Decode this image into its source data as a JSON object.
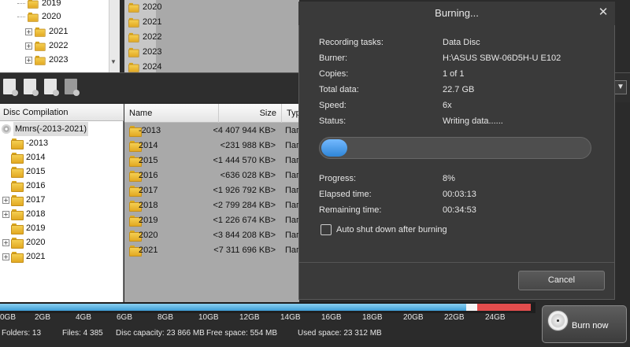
{
  "top_tree": {
    "years": [
      "2019",
      "2020",
      "2021",
      "2022",
      "2023"
    ]
  },
  "top_list": {
    "years": [
      "2020",
      "2021",
      "2022",
      "2023",
      "2024"
    ]
  },
  "compilation": {
    "header": "Disc Compilation",
    "root_label": "Mmrs(-2013-2021)",
    "folders": [
      "-2013",
      "2014",
      "2015",
      "2016",
      "2017",
      "2018",
      "2019",
      "2020",
      "2021"
    ]
  },
  "table": {
    "col_name": "Name",
    "col_size": "Size",
    "col_type": "Typ",
    "rows": [
      {
        "name": "-2013",
        "size": "<4 407 944 KB>",
        "type": "Пап"
      },
      {
        "name": "2014",
        "size": "<231 988 KB>",
        "type": "Пап"
      },
      {
        "name": "2015",
        "size": "<1 444 570 KB>",
        "type": "Пап"
      },
      {
        "name": "2016",
        "size": "<636 028 KB>",
        "type": "Пап"
      },
      {
        "name": "2017",
        "size": "<1 926 792 KB>",
        "type": "Пап"
      },
      {
        "name": "2018",
        "size": "<2 799 284 KB>",
        "type": "Пап"
      },
      {
        "name": "2019",
        "size": "<1 226 674 KB>",
        "type": "Пап"
      },
      {
        "name": "2020",
        "size": "<3 844 208 KB>",
        "type": "Пап"
      },
      {
        "name": "2021",
        "size": "<7 311 696 KB>",
        "type": "Пап"
      }
    ]
  },
  "dialog": {
    "title": "Burning...",
    "close": "✕",
    "recording_tasks_label": "Recording tasks:",
    "recording_tasks_value": "Data Disc",
    "burner_label": "Burner:",
    "burner_value": "H:\\ASUS SBW-06D5H-U E102",
    "copies_label": "Copies:",
    "copies_value": "1 of 1",
    "total_data_label": "Total data:",
    "total_data_value": "22.7 GB",
    "speed_label": "Speed:",
    "speed_value": "6x",
    "status_label": "Status:",
    "status_value": "Writing data......",
    "progress_label": "Progress:",
    "progress_value": "8%",
    "progress_fraction": 0.08,
    "elapsed_label": "Elapsed time:",
    "elapsed_value": "00:03:13",
    "remaining_label": "Remaining time:",
    "remaining_value": "00:34:53",
    "auto_shutdown_label": "Auto shut down after burning",
    "cancel_label": "Cancel"
  },
  "capacity": {
    "ticks": [
      "0GB",
      "2GB",
      "4GB",
      "6GB",
      "8GB",
      "10GB",
      "12GB",
      "14GB",
      "16GB",
      "18GB",
      "20GB",
      "22GB",
      "24GB"
    ],
    "used_gb": 22.7,
    "max_gb": 26
  },
  "status": {
    "folders": "Folders: 13",
    "files": "Files: 4 385",
    "disc_capacity": "Disc capacity: 23 866 MB",
    "free_space": "Free space: 554 MB",
    "used_space": "Used space: 23 312 MB"
  },
  "burn_button": {
    "label": "Burn now"
  }
}
